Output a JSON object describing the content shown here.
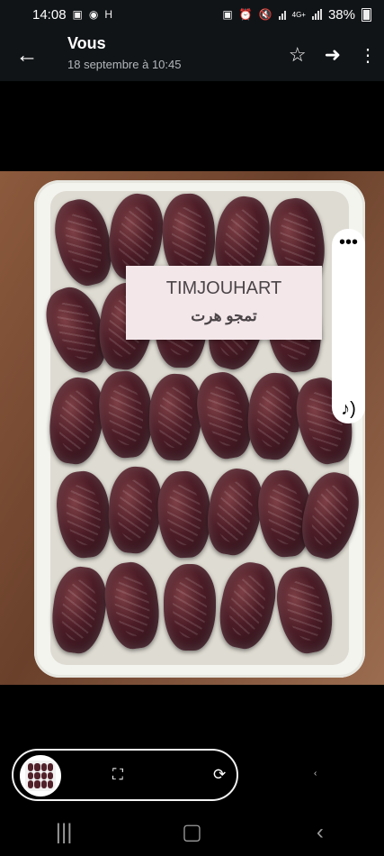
{
  "status": {
    "time": "14:08",
    "battery": "38%",
    "network": "4G+"
  },
  "header": {
    "title": "Vous",
    "subtitle": "18 septembre à 10:45"
  },
  "photo": {
    "label_latin": "TIMJOUHART",
    "label_arabic": "تمجو هرت"
  },
  "icons": {
    "back": "arrow-left-icon",
    "favorite": "star-icon",
    "forward": "share-arrow-icon",
    "more": "vertical-dots-icon",
    "options": "horizontal-dots-icon",
    "sound": "music-note-sound-icon",
    "scan": "scan-icon",
    "rotate": "rotate-icon",
    "recent_apps": "recent-apps-icon",
    "home": "home-icon",
    "back_nav": "back-navigation-icon"
  },
  "colors": {
    "status_bg": "#111417",
    "date_color": "#4c1c26",
    "tray_color": "#f4f4ef"
  }
}
